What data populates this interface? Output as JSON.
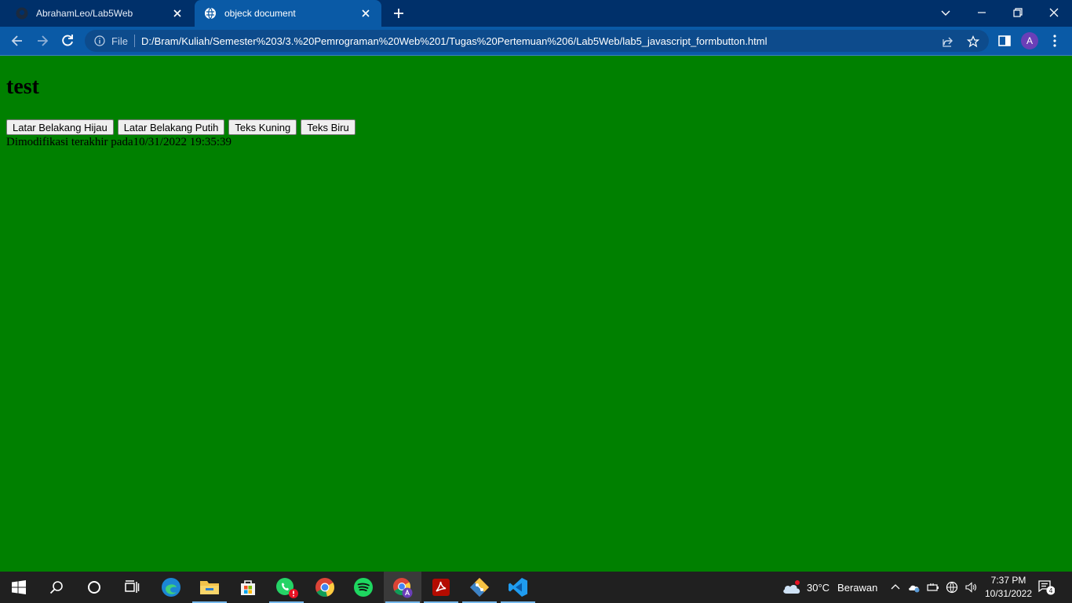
{
  "browser": {
    "tabs": [
      {
        "title": "AbrahamLeo/Lab5Web",
        "icon": "github-icon",
        "active": false
      },
      {
        "title": "objeck document",
        "icon": "globe-icon",
        "active": true
      }
    ],
    "address": {
      "protocol_label": "File",
      "url": "D:/Bram/Kuliah/Semester%203/3.%20Pemrograman%20Web%201/Tugas%20Pertemuan%206/Lab5Web/lab5_javascript_formbutton.html"
    },
    "profile_initial": "A"
  },
  "page": {
    "heading": "test",
    "buttons": [
      "Latar Belakang Hijau",
      "Latar Belakang Putih",
      "Teks Kuning",
      "Teks Biru"
    ],
    "modified_text": "Dimodifikasi terakhir pada10/31/2022 19:35:39",
    "background_color": "#008000"
  },
  "taskbar": {
    "apps": [
      "start-icon",
      "search-icon",
      "cortana-icon",
      "task-view-icon",
      "edge-icon",
      "file-explorer-icon",
      "store-icon",
      "whatsapp-icon",
      "chrome-icon",
      "spotify-icon",
      "chrome-profile-icon",
      "acrobat-icon",
      "git-icon",
      "vscode-icon"
    ],
    "weather": {
      "temp": "30°C",
      "condition": "Berawan"
    },
    "clock": {
      "time": "7:37 PM",
      "date": "10/31/2022"
    },
    "notification_count": "4"
  },
  "colors": {
    "tab_strip": "#00306a",
    "toolbar": "#0a5aa6",
    "taskbar": "#202020"
  }
}
